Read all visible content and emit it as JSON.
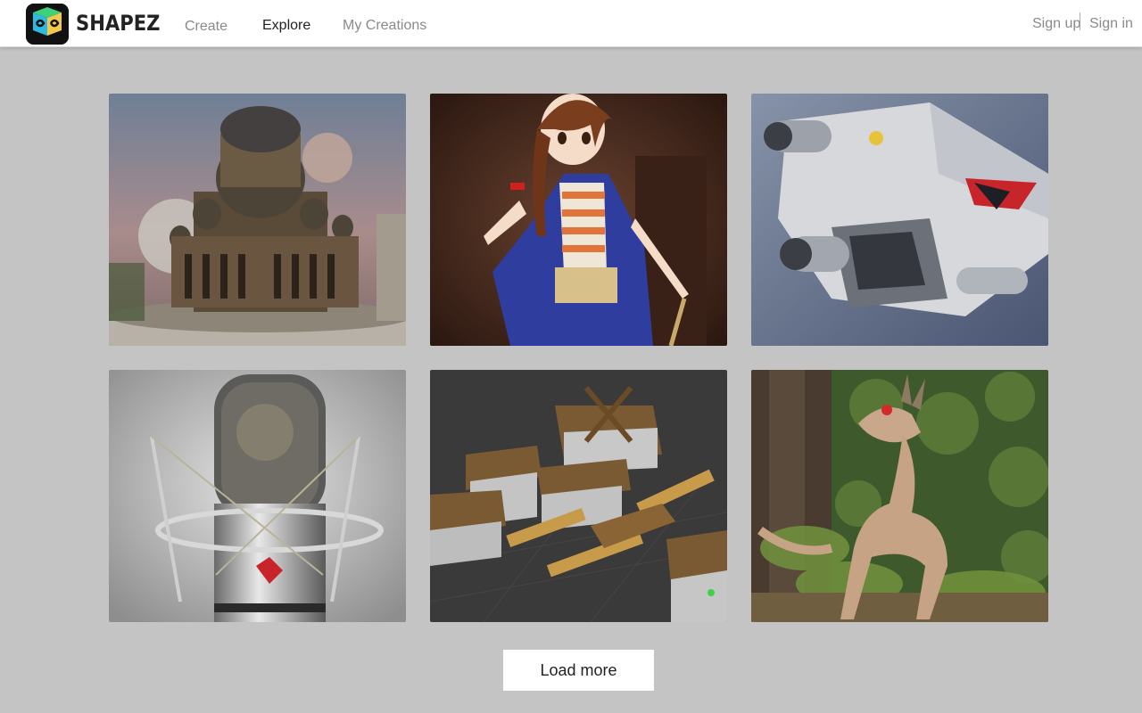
{
  "header": {
    "brand": "SHAPEZ",
    "nav": [
      {
        "label": "Create",
        "active": false
      },
      {
        "label": "Explore",
        "active": true
      },
      {
        "label": "My Creations",
        "active": false
      }
    ],
    "sign_up": "Sign up",
    "sign_in": "Sign in"
  },
  "gallery": {
    "items": [
      {
        "icon": "fantasy-castle-image"
      },
      {
        "icon": "anime-pirate-girl-image"
      },
      {
        "icon": "spaceship-image"
      },
      {
        "icon": "studio-microphone-image"
      },
      {
        "icon": "medieval-village-image"
      },
      {
        "icon": "dragon-creature-image"
      }
    ],
    "load_more": "Load more"
  },
  "colors": {
    "background": "#c4c4c4",
    "header": "#ffffff",
    "nav_active": "#222222",
    "nav_inactive": "#8a8a8a"
  }
}
